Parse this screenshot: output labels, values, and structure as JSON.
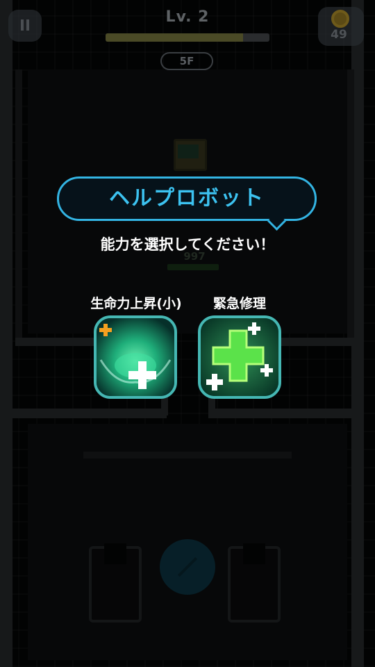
{
  "hud": {
    "level_label": "Lv. 2",
    "floor_label": "5F",
    "coins": "49",
    "xp_progress": 0.84
  },
  "robot": {
    "hp_value": "997"
  },
  "dialog": {
    "title": "ヘルプロボット",
    "prompt": "能力を選択してください！",
    "options": [
      {
        "label": "生命力上昇(小)",
        "icon": "heal-swirl-icon"
      },
      {
        "label": "緊急修理",
        "icon": "big-green-cross-icon"
      }
    ]
  },
  "colors": {
    "accent": "#3cc2f0",
    "card_border": "#45b7b3",
    "heal_green": "#5be24a"
  }
}
